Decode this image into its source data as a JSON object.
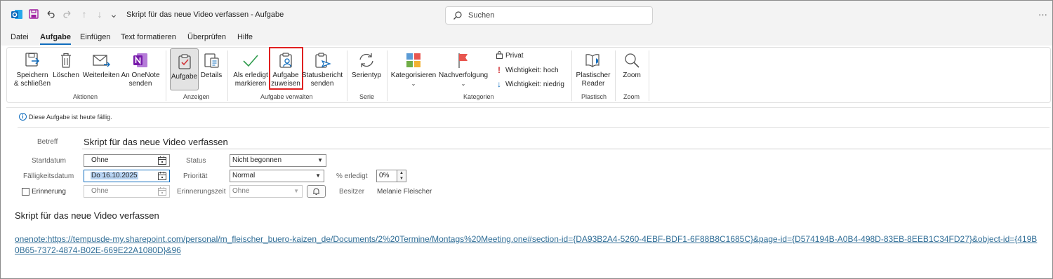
{
  "titlebar": {
    "title": "Skript für das neue Video verfassen  -  Aufgabe",
    "search_placeholder": "Suchen"
  },
  "menu": {
    "tabs": [
      "Datei",
      "Aufgabe",
      "Einfügen",
      "Text formatieren",
      "Überprüfen",
      "Hilfe"
    ],
    "active": "Aufgabe"
  },
  "ribbon": {
    "actions": {
      "group": "Aktionen",
      "save": "Speichern\n& schließen",
      "delete": "Löschen",
      "forward": "Weiterleiten",
      "onenote": "An OneNote\nsenden"
    },
    "show": {
      "group": "Anzeigen",
      "task": "Aufgabe",
      "details": "Details"
    },
    "manage": {
      "group": "Aufgabe verwalten",
      "mark_complete": "Als erledigt\nmarkieren",
      "assign": "Aufgabe\nzuweisen",
      "status_report": "Statusbericht\nsenden"
    },
    "series": {
      "group": "Serie",
      "recurrence": "Serientyp"
    },
    "categories": {
      "group": "Kategorien",
      "categorize": "Kategorisieren",
      "followup": "Nachverfolgung",
      "private": "Privat",
      "high": "Wichtigkeit: hoch",
      "low": "Wichtigkeit: niedrig"
    },
    "immersive": {
      "group": "Plastisch",
      "reader": "Plastischer\nReader"
    },
    "zoom": {
      "group": "Zoom",
      "zoom": "Zoom"
    }
  },
  "info": "Diese Aufgabe ist heute fällig.",
  "form": {
    "subject_label": "Betreff",
    "subject_value": "Skript für das neue Video verfassen",
    "start_label": "Startdatum",
    "start_value": "Ohne",
    "due_label": "Fälligkeitsdatum",
    "due_value": "Do 16.10.2025",
    "reminder_label": "Erinnerung",
    "reminder_date": "Ohne",
    "status_label": "Status",
    "status_value": "Nicht begonnen",
    "priority_label": "Priorität",
    "priority_value": "Normal",
    "reminder_time_label": "Erinnerungszeit",
    "reminder_time_value": "Ohne",
    "percent_label": "% erledigt",
    "percent_value": "0%",
    "owner_label": "Besitzer",
    "owner_value": "Melanie Fleischer"
  },
  "body": {
    "title": "Skript für das neue Video verfassen",
    "link": "onenote:https://tempusde-my.sharepoint.com/personal/m_fleischer_buero-kaizen_de/Documents/2%20Termine/Montags%20Meeting.one#section-id={DA93B2A4-5260-4EBF-BDF1-6F88B8C1685C}&page-id={D574194B-A0B4-498D-83EB-8EEB1C34FD27}&object-id={419B0B65-7372-4874-B02E-669E22A1080D}&96"
  },
  "colors": {
    "accent": "#0f6cbd",
    "highlight": "#e02020",
    "onenote": "#7719aa",
    "link": "#2f6d96"
  }
}
